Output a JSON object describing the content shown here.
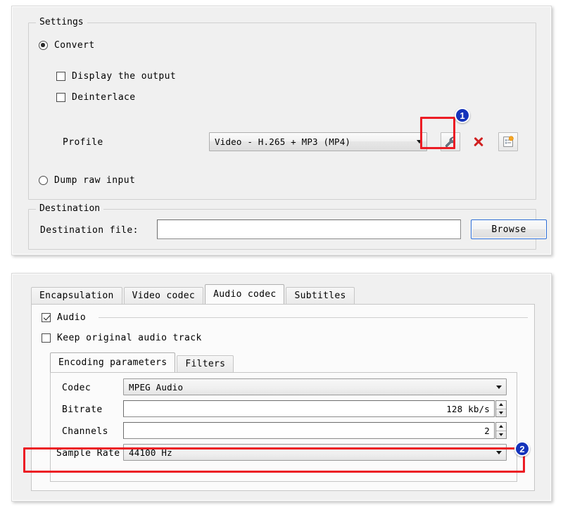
{
  "top_panel": {
    "settings_group": {
      "title": "Settings",
      "convert_radio": {
        "label": "Convert",
        "checked": true
      },
      "display_output_check": {
        "label": "Display the output",
        "checked": false
      },
      "deinterlace_check": {
        "label": "Deinterlace",
        "checked": false
      },
      "profile_label": "Profile",
      "profile_value": "Video - H.265 + MP3 (MP4)",
      "edit_profile_icon": "wrench-icon",
      "delete_profile_icon": "red-x-icon",
      "new_profile_icon": "new-profile-icon",
      "dump_raw_radio": {
        "label": "Dump raw input",
        "checked": false
      }
    },
    "destination_group": {
      "title": "Destination",
      "file_label": "Destination file:",
      "file_value": "",
      "browse_label": "Browse"
    }
  },
  "bottom_panel": {
    "tabs": [
      {
        "label": "Encapsulation",
        "active": false
      },
      {
        "label": "Video codec",
        "active": false
      },
      {
        "label": "Audio codec",
        "active": true
      },
      {
        "label": "Subtitles",
        "active": false
      }
    ],
    "audio_check": {
      "label": "Audio",
      "checked": true
    },
    "keep_original_check": {
      "label": "Keep original audio track",
      "checked": false
    },
    "inner_tabs": [
      {
        "label": "Encoding parameters",
        "active": true
      },
      {
        "label": "Filters",
        "active": false
      }
    ],
    "fields": {
      "codec_label": "Codec",
      "codec_value": "MPEG Audio",
      "bitrate_label": "Bitrate",
      "bitrate_value": "128 kb/s",
      "channels_label": "Channels",
      "channels_value": "2",
      "samplerate_label": "Sample Rate",
      "samplerate_value": "44100 Hz"
    }
  },
  "annotations": {
    "badge_one": "1",
    "badge_two": "2",
    "highlight_color": "#ec1c24",
    "badge_color": "#1433bb"
  }
}
